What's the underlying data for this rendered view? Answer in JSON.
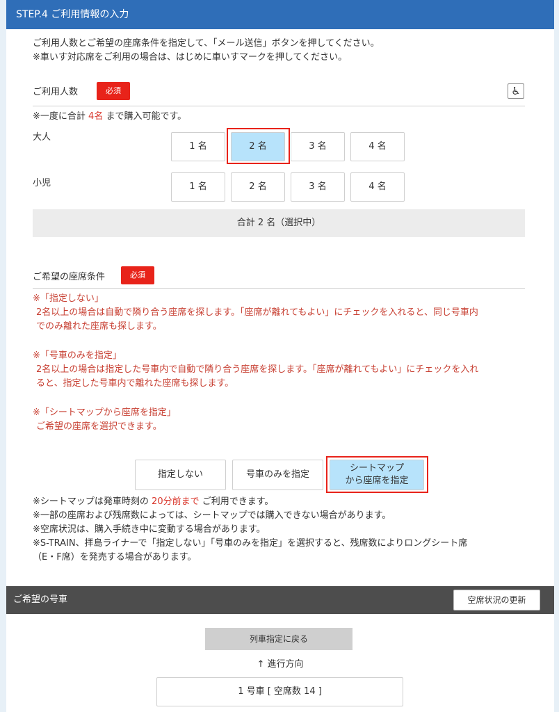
{
  "step_title": "STEP.4 ご利用情報の入力",
  "intro": [
    "ご利用人数とご希望の座席条件を指定して、「メール送信」ボタンを押してください。",
    "※車いす対応席をご利用の場合は、はじめに車いすマークを押してください。"
  ],
  "persons": {
    "label": "ご利用人数",
    "required": "必須",
    "wheelchair_icon": "wheelchair-icon",
    "limit_prefix": "※一度に合計",
    "limit_value": "4名",
    "limit_suffix": "まで購入可能です。",
    "adult_label": "大人",
    "child_label": "小児",
    "adult_options": [
      "1 名",
      "2 名",
      "3 名",
      "4 名"
    ],
    "adult_selected": "2 名",
    "child_options": [
      "1 名",
      "2 名",
      "3 名",
      "4 名"
    ],
    "total": "合計 2 名（選択中）"
  },
  "seat": {
    "label": "ご希望の座席条件",
    "required": "必須",
    "note1_title": "※「指定しない」",
    "note1_line1": "2名以上の場合は自動で隣り合う座席を探します。「座席が離れてもよい」にチェックを入れると、同じ号車内",
    "note1_line2": "でのみ離れた座席も探します。",
    "note2_title": "※「号車のみを指定」",
    "note2_line1": "2名以上の場合は指定した号車内で自動で隣り合う座席を探します。「座席が離れてもよい」にチェックを入れ",
    "note2_line2": "ると、指定した号車内で離れた座席も探します。",
    "note3_title": "※「シートマップから座席を指定」",
    "note3_line1": "ご希望の座席を選択できます。",
    "btn_none": "指定しない",
    "btn_car_only": "号車のみを指定",
    "btn_map_line1": "シートマップ",
    "btn_map_line2": "から座席を指定",
    "selected": "シートマップから座席を指定"
  },
  "sub_notes": {
    "map_prefix": "※シートマップは発車時刻の",
    "map_value": "20分前まで",
    "map_suffix": "ご利用できます。",
    "line2": "※一部の座席および残席数によっては、シートマップでは購入できない場合があります。",
    "line3": "※空席状況は、購入手続き中に変動する場合があります。",
    "line4": "※S-TRAIN、拝島ライナーで「指定しない」「号車のみを指定」を選択すると、残席数によりロングシート席",
    "line5": "（E・F席）を発売する場合があります。"
  },
  "car_section": {
    "title": "ご希望の号車",
    "refresh": "空席状況の更新",
    "back": "列車指定に戻る",
    "direction_arrow": "↑",
    "direction": "進行方向",
    "car1": "1 号車 [ 空席数 14 ]"
  },
  "colors": {
    "header_blue": "#2f6eb8",
    "required_red": "#e8231a",
    "selected_blue": "#b7e3fb",
    "note_red": "#c84033",
    "dark_bar": "#4d4d4d"
  }
}
